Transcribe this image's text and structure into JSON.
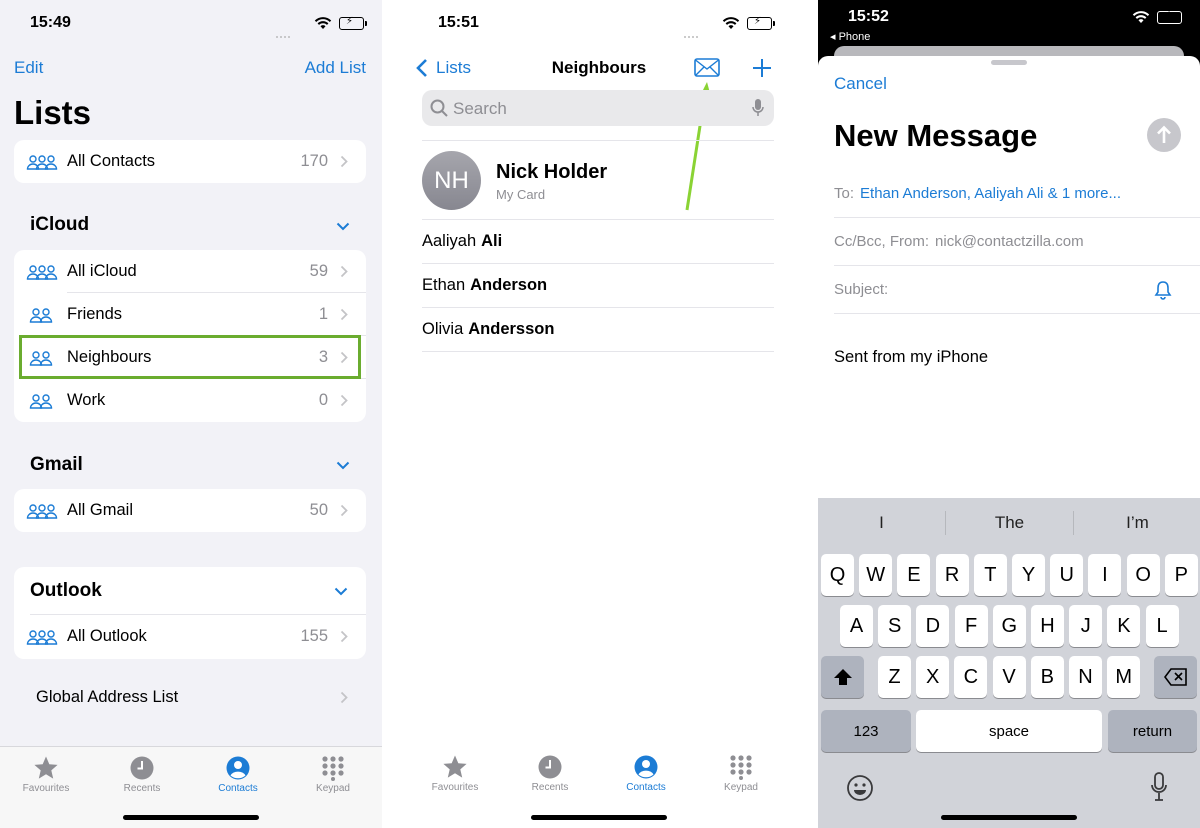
{
  "screen1": {
    "time": "15:49",
    "nav": {
      "edit": "Edit",
      "add_list": "Add List"
    },
    "title": "Lists",
    "all_contacts": {
      "label": "All Contacts",
      "count": "170"
    },
    "icloud": {
      "header": "iCloud",
      "items": [
        {
          "label": "All iCloud",
          "count": "59"
        },
        {
          "label": "Friends",
          "count": "1"
        },
        {
          "label": "Neighbours",
          "count": "3"
        },
        {
          "label": "Work",
          "count": "0"
        }
      ]
    },
    "gmail": {
      "header": "Gmail",
      "items": [
        {
          "label": "All Gmail",
          "count": "50"
        }
      ]
    },
    "outlook": {
      "header": "Outlook",
      "items": [
        {
          "label": "All Outlook",
          "count": "155"
        }
      ]
    },
    "global_address_list": "Global Address List"
  },
  "tabs": {
    "favourites": "Favourites",
    "recents": "Recents",
    "contacts": "Contacts",
    "keypad": "Keypad"
  },
  "screen2": {
    "time": "15:51",
    "back": "Lists",
    "title": "Neighbours",
    "search_placeholder": "Search",
    "my_card": {
      "initials": "NH",
      "name": "Nick Holder",
      "subtitle": "My Card"
    },
    "contacts": [
      {
        "first": "Aaliyah",
        "last": "Ali"
      },
      {
        "first": "Ethan",
        "last": "Anderson"
      },
      {
        "first": "Olivia",
        "last": "Andersson"
      }
    ]
  },
  "screen3": {
    "time": "15:52",
    "back_app": "◂ Phone",
    "cancel": "Cancel",
    "title": "New Message",
    "to_label": "To:",
    "to_value": "Ethan Anderson, Aaliyah Ali & 1 more...",
    "cc_label": "Cc/Bcc, From:",
    "cc_value": "nick@contactzilla.com",
    "subject_label": "Subject:",
    "body": "Sent from my iPhone",
    "suggestions": [
      "I",
      "The",
      "I’m"
    ],
    "keyboard": {
      "row1": [
        "Q",
        "W",
        "E",
        "R",
        "T",
        "Y",
        "U",
        "I",
        "O",
        "P"
      ],
      "row2": [
        "A",
        "S",
        "D",
        "F",
        "G",
        "H",
        "J",
        "K",
        "L"
      ],
      "row3": [
        "Z",
        "X",
        "C",
        "V",
        "B",
        "N",
        "M"
      ],
      "numbers": "123",
      "space": "space",
      "return": "return"
    }
  },
  "colors": {
    "accent": "#1c7cd5",
    "highlight": "#6aac2f",
    "battery": "#34c759"
  }
}
